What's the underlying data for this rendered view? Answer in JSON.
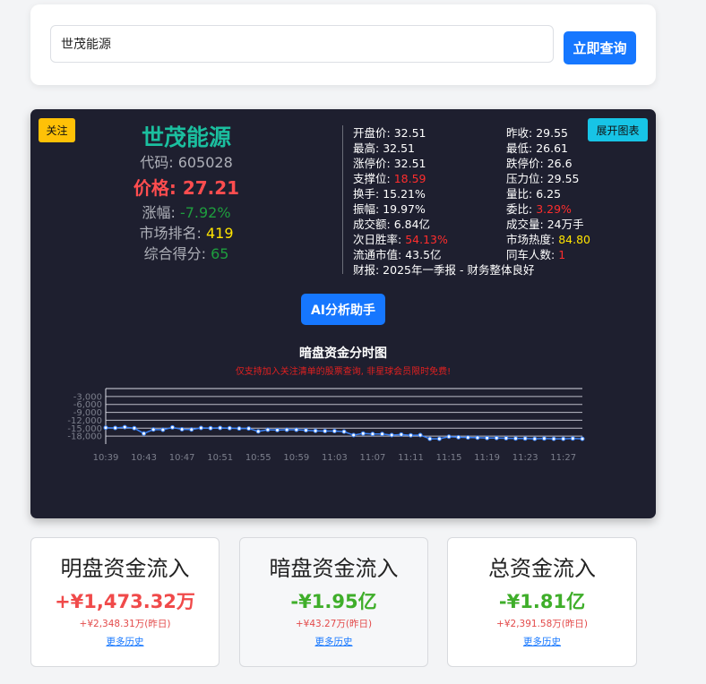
{
  "search": {
    "value": "世茂能源",
    "button_label": "立即查询"
  },
  "stock": {
    "follow_label": "关注",
    "expand_label": "展开图表",
    "name": "世茂能源",
    "code_label": "代码: 605028",
    "price_label": "价格: 27.21",
    "change_label": "涨幅: ",
    "change_value": "-7.92%",
    "rank_label": "市场排名: ",
    "rank_value": "419",
    "score_label": "综合得分: ",
    "score_value": "65",
    "metrics_left": [
      {
        "label": "开盘价: ",
        "value": "32.51",
        "highlight": ""
      },
      {
        "label": "最高: ",
        "value": "32.51",
        "highlight": ""
      },
      {
        "label": "涨停价: ",
        "value": "32.51",
        "highlight": ""
      },
      {
        "label": "支撑位: ",
        "value": "18.59",
        "highlight": "red"
      },
      {
        "label": "换手: ",
        "value": "15.21%",
        "highlight": ""
      },
      {
        "label": "振幅: ",
        "value": "19.97%",
        "highlight": ""
      },
      {
        "label": "成交额: ",
        "value": "6.84亿",
        "highlight": ""
      },
      {
        "label": "次日胜率: ",
        "value": "54.13%",
        "highlight": "red"
      },
      {
        "label": "流通市值: ",
        "value": "43.5亿",
        "highlight": ""
      }
    ],
    "metrics_right": [
      {
        "label": "昨收: ",
        "value": "29.55",
        "highlight": ""
      },
      {
        "label": "最低: ",
        "value": "26.61",
        "highlight": ""
      },
      {
        "label": "跌停价: ",
        "value": "26.6",
        "highlight": ""
      },
      {
        "label": "压力位: ",
        "value": "29.55",
        "highlight": ""
      },
      {
        "label": "量比: ",
        "value": "6.25",
        "highlight": ""
      },
      {
        "label": "委比: ",
        "value": "3.29%",
        "highlight": "red"
      },
      {
        "label": "成交量: ",
        "value": "24万手",
        "highlight": ""
      },
      {
        "label": "市场热度: ",
        "value": "84.80",
        "highlight": "yellow"
      },
      {
        "label": "同车人数: ",
        "value": "1",
        "highlight": "red"
      }
    ],
    "report_line": "财报: 2025年一季报 - 财务整体良好",
    "ai_button_label": "AI分析助手"
  },
  "chart_data": {
    "type": "line",
    "title": "暗盘资金分时图",
    "subtitle": "仅支持加入关注清单的股票查询, 非星球会员限时免费!",
    "xlabel": "",
    "ylabel": "",
    "x_tick_labels": [
      "10:39",
      "10:43",
      "10:47",
      "10:51",
      "10:55",
      "10:59",
      "11:03",
      "11:07",
      "11:11",
      "11:15",
      "11:19",
      "11:23",
      "11:27"
    ],
    "y_tick_labels": [
      "-3,000",
      "-6,000",
      "-9,000",
      "-12,000",
      "-15,000",
      "-18,000"
    ],
    "ylim": [
      -21000,
      0
    ],
    "grid": true,
    "line_color": "#3b82f6",
    "x": [
      "10:39",
      "10:40",
      "10:41",
      "10:42",
      "10:43",
      "10:44",
      "10:45",
      "10:46",
      "10:47",
      "10:48",
      "10:49",
      "10:50",
      "10:51",
      "10:52",
      "10:53",
      "10:54",
      "10:55",
      "10:56",
      "10:57",
      "10:58",
      "10:59",
      "11:00",
      "11:01",
      "11:02",
      "11:03",
      "11:04",
      "11:05",
      "11:06",
      "11:07",
      "11:08",
      "11:09",
      "11:10",
      "11:11",
      "11:12",
      "11:13",
      "11:14",
      "11:15",
      "11:16",
      "11:17",
      "11:18",
      "11:19",
      "11:20",
      "11:21",
      "11:22",
      "11:23",
      "11:24",
      "11:25",
      "11:26",
      "11:27",
      "11:28",
      "11:29"
    ],
    "values": [
      -14800,
      -14900,
      -14600,
      -15000,
      -17000,
      -15500,
      -15600,
      -14700,
      -15400,
      -15500,
      -14900,
      -15000,
      -14900,
      -15000,
      -15100,
      -15100,
      -16200,
      -15600,
      -15700,
      -15600,
      -15600,
      -15800,
      -16000,
      -16100,
      -16100,
      -16300,
      -17600,
      -17000,
      -17200,
      -17200,
      -17600,
      -17400,
      -17700,
      -17600,
      -19000,
      -19000,
      -18200,
      -18400,
      -18500,
      -18600,
      -18700,
      -18700,
      -18800,
      -18900,
      -18900,
      -19000,
      -18900,
      -19000,
      -19000,
      -18900,
      -19000
    ]
  },
  "flows": [
    {
      "title": "明盘资金流入",
      "value": "+¥1,473.32万",
      "sign": "pos",
      "yesterday": "+¥2,348.31万(昨日)",
      "link": "更多历史"
    },
    {
      "title": "暗盘资金流入",
      "value": "-¥1.95亿",
      "sign": "neg",
      "yesterday": "+¥43.27万(昨日)",
      "link": "更多历史"
    },
    {
      "title": "总资金流入",
      "value": "-¥1.81亿",
      "sign": "neg",
      "yesterday": "+¥2,391.58万(昨日)",
      "link": "更多历史"
    }
  ]
}
